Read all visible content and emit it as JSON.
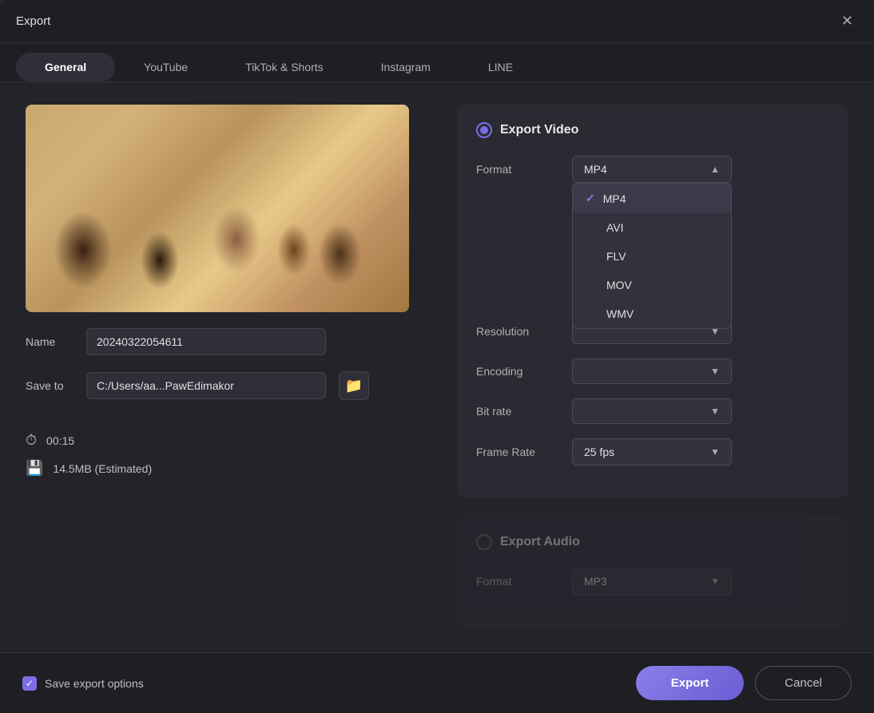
{
  "dialog": {
    "title": "Export",
    "close_label": "✕"
  },
  "tabs": [
    {
      "id": "general",
      "label": "General",
      "active": true
    },
    {
      "id": "youtube",
      "label": "YouTube",
      "active": false
    },
    {
      "id": "tiktok",
      "label": "TikTok & Shorts",
      "active": false
    },
    {
      "id": "instagram",
      "label": "Instagram",
      "active": false
    },
    {
      "id": "line",
      "label": "LINE",
      "active": false
    }
  ],
  "left": {
    "name_label": "Name",
    "name_value": "20240322054611",
    "save_to_label": "Save to",
    "save_to_value": "C:/Users/aa...PawEdimakor",
    "duration_icon": "⏱",
    "duration": "00:15",
    "size_icon": "💾",
    "size": "14.5MB (Estimated)"
  },
  "right": {
    "export_video_label": "Export Video",
    "format_label": "Format",
    "format_value": "MP4",
    "resolution_label": "Resolution",
    "encoding_label": "Encoding",
    "bit_rate_label": "Bit rate",
    "frame_rate_label": "Frame Rate",
    "frame_rate_value": "25  fps",
    "format_options": [
      {
        "value": "MP4",
        "selected": true
      },
      {
        "value": "AVI",
        "selected": false
      },
      {
        "value": "FLV",
        "selected": false
      },
      {
        "value": "MOV",
        "selected": false
      },
      {
        "value": "WMV",
        "selected": false
      }
    ],
    "export_audio_label": "Export Audio",
    "audio_format_label": "Format",
    "audio_format_value": "MP3"
  },
  "bottom": {
    "save_options_label": "Save export options",
    "export_btn_label": "Export",
    "cancel_btn_label": "Cancel"
  }
}
